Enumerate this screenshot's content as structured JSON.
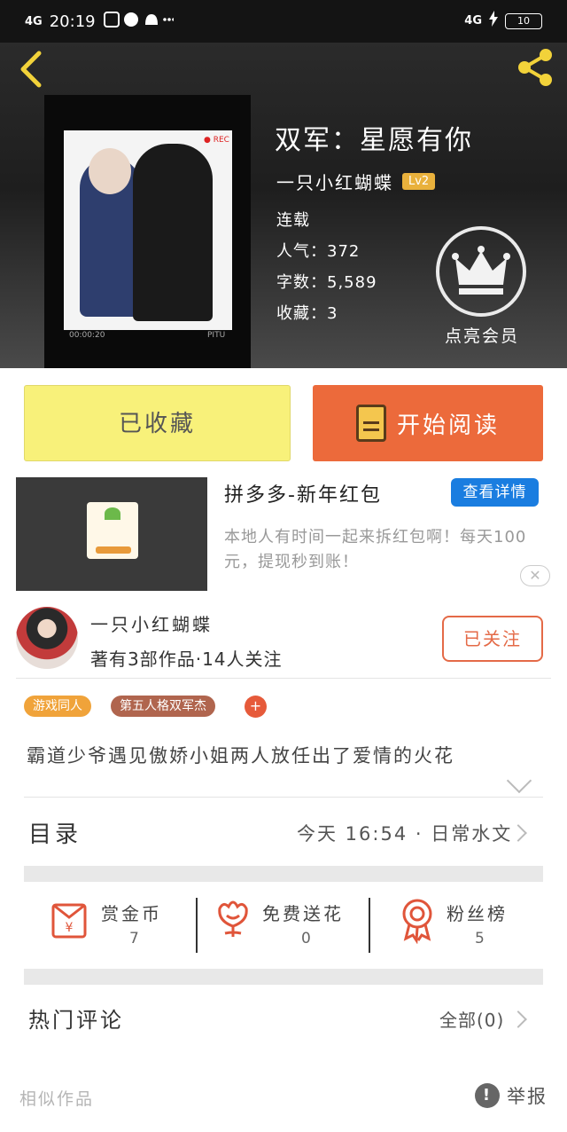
{
  "status_bar": {
    "signal_left": "4G",
    "time": "20:19",
    "signal_right": "4G",
    "battery": "10"
  },
  "book": {
    "title": "双军：星愿有你",
    "author": "一只小红蝴蝶",
    "level": "Lv2",
    "status": "连载",
    "popularity": "人气：372",
    "word_count": "字数：5,589",
    "favorites": "收藏：3"
  },
  "cover": {
    "rec_label": "● REC",
    "timestamp": "00:00:20",
    "brand": "PITU"
  },
  "vip": {
    "label": "点亮会员"
  },
  "actions": {
    "favorited": "已收藏",
    "start_reading": "开始阅读"
  },
  "ad": {
    "title": "拼多多-新年红包",
    "detail_button": "查看详情",
    "description": "本地人有时间一起来拆红包啊！每天100元，提现秒到账！",
    "close": "✕"
  },
  "author_card": {
    "name": "一只小红蝴蝶",
    "stats": "著有3部作品·14人关注",
    "follow_button": "已关注"
  },
  "tags": [
    "游戏同人",
    "第五人格双军杰"
  ],
  "tag_add": "+",
  "synopsis": "霸道少爷遇见傲娇小姐两人放任出了爱情的火花",
  "toc": {
    "label": "目录",
    "latest": "今天 16:54 · 日常水文"
  },
  "stats": [
    {
      "label": "赏金币",
      "count": "7"
    },
    {
      "label": "免费送花",
      "count": "0"
    },
    {
      "label": "粉丝榜",
      "count": "5"
    }
  ],
  "comments": {
    "label": "热门评论",
    "all": "全部(0)"
  },
  "footer": {
    "similar": "相似作品",
    "report": "举报",
    "report_icon": "!"
  },
  "colors": {
    "accent_orange": "#ec6a3b",
    "favorite_yellow": "#f8f17a",
    "ad_blue": "#1a7de0",
    "share_yellow": "#f2d23a"
  }
}
